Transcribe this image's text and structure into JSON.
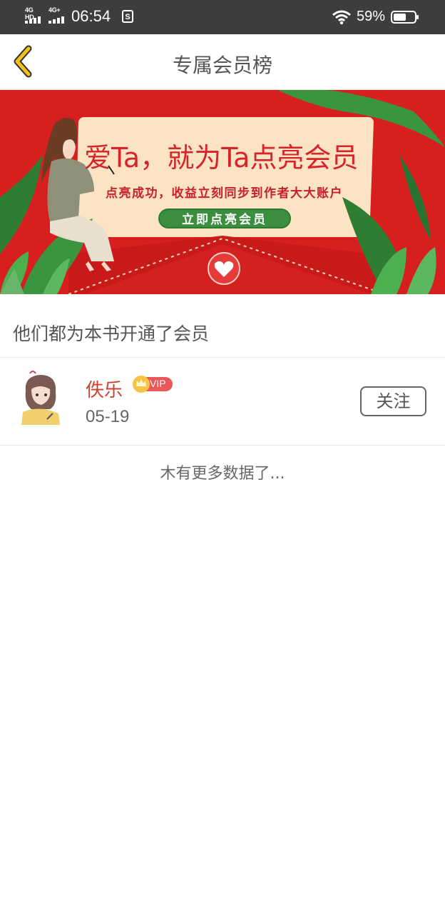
{
  "status_bar": {
    "signal1_label": "4G HD",
    "signal2_label": "4G+",
    "time": "06:54",
    "battery": "59%"
  },
  "header": {
    "title": "专属会员榜",
    "back_icon": "chevron-left-icon",
    "accent_color": "#f2c020"
  },
  "banner": {
    "headline": "爱Ta，就为Ta点亮会员",
    "subtitle": "点亮成功，收益立刻同步到作者大大账户",
    "button_label": "立即点亮会员",
    "bg_color": "#d71f1f"
  },
  "section": {
    "title": "他们都为本书开通了会员"
  },
  "members": [
    {
      "name": "佚乐",
      "badge": "VIP",
      "date": "05-19",
      "follow_label": "关注"
    }
  ],
  "footer": {
    "no_more": "木有更多数据了..."
  }
}
